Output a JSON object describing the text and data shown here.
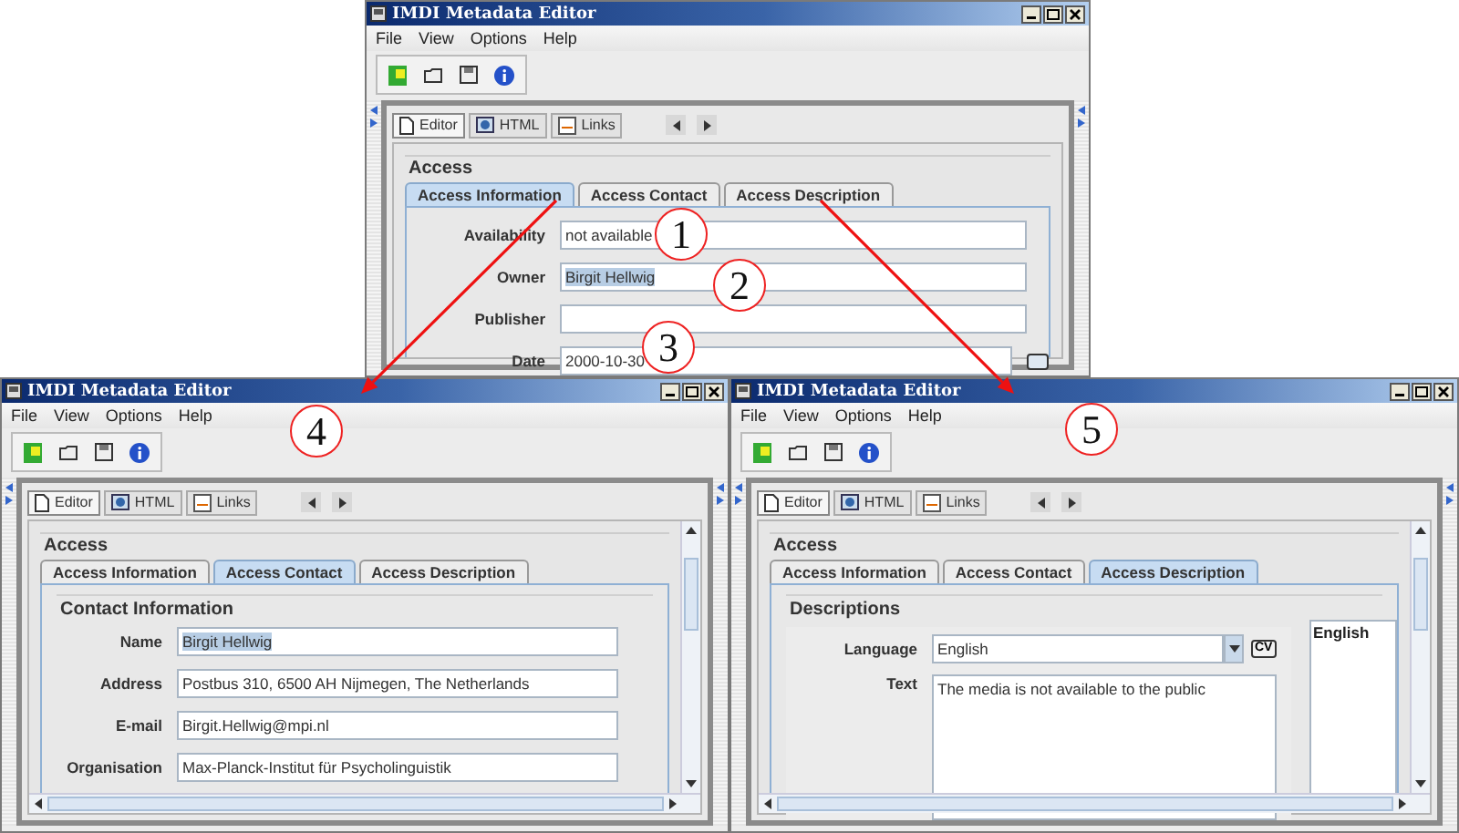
{
  "windows": [
    {
      "title": "IMDI Metadata Editor",
      "menu": [
        "File",
        "View",
        "Options",
        "Help"
      ],
      "view_tabs": [
        {
          "label": "Editor",
          "selected": true
        },
        {
          "label": "HTML",
          "selected": false
        },
        {
          "label": "Links",
          "selected": false
        }
      ],
      "section": "Access",
      "tabs": [
        {
          "label": "Access Information",
          "selected": true
        },
        {
          "label": "Access Contact",
          "selected": false
        },
        {
          "label": "Access Description",
          "selected": false
        }
      ],
      "content": {
        "kind": "info",
        "fields": [
          {
            "label": "Availability",
            "value": "not available",
            "kind": "text",
            "highlighted": false
          },
          {
            "label": "Owner",
            "value": "Birgit Hellwig",
            "kind": "text",
            "highlighted": true
          },
          {
            "label": "Publisher",
            "kind": "text"
          },
          {
            "label": "Date",
            "value": "2000-10-30",
            "kind": "date",
            "highlighted": false
          }
        ]
      }
    },
    {
      "title": "IMDI Metadata Editor",
      "menu": [
        "File",
        "View",
        "Options",
        "Help"
      ],
      "view_tabs": [
        {
          "label": "Editor",
          "selected": true
        },
        {
          "label": "HTML",
          "selected": false
        },
        {
          "label": "Links",
          "selected": false
        }
      ],
      "section": "Access",
      "tabs": [
        {
          "label": "Access Information",
          "selected": false
        },
        {
          "label": "Access Contact",
          "selected": true
        },
        {
          "label": "Access Description",
          "selected": false
        }
      ],
      "content": {
        "kind": "contact",
        "heading": "Contact Information",
        "fields": [
          {
            "label": "Name",
            "value": "Birgit Hellwig",
            "kind": "text",
            "highlighted": true
          },
          {
            "label": "Address",
            "value": "Postbus 310, 6500 AH Nijmegen, The Netherlands",
            "kind": "text",
            "highlighted": false
          },
          {
            "label": "E-mail",
            "value": "Birgit.Hellwig@mpi.nl",
            "kind": "text",
            "highlighted": false
          },
          {
            "label": "Organisation",
            "value": "Max-Planck-Institut für Psycholinguistik",
            "kind": "text",
            "highlighted": false
          }
        ]
      }
    },
    {
      "title": "IMDI Metadata Editor",
      "menu": [
        "File",
        "View",
        "Options",
        "Help"
      ],
      "view_tabs": [
        {
          "label": "Editor",
          "selected": true
        },
        {
          "label": "HTML",
          "selected": false
        },
        {
          "label": "Links",
          "selected": false
        }
      ],
      "section": "Access",
      "tabs": [
        {
          "label": "Access Information",
          "selected": false
        },
        {
          "label": "Access Contact",
          "selected": false
        },
        {
          "label": "Access Description",
          "selected": true
        }
      ],
      "content": {
        "kind": "description",
        "heading": "Descriptions",
        "language_label": "Language",
        "language": "English",
        "cv_button": "CV",
        "text_label": "Text",
        "text": "The media is not available to the public",
        "languages": [
          "English"
        ]
      }
    }
  ],
  "callouts": [
    "1",
    "2",
    "3",
    "4",
    "5"
  ]
}
